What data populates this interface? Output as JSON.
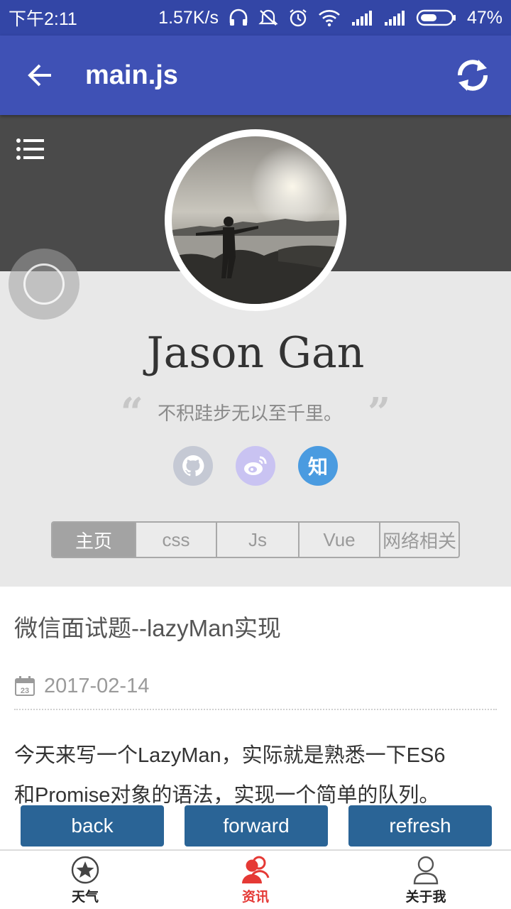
{
  "status_bar": {
    "time": "下午2:11",
    "network_speed": "1.57K/s",
    "battery": "47%",
    "icons": [
      "headset-icon",
      "mute-icon",
      "alarm-icon",
      "wifi-icon",
      "signal-icon",
      "signal-icon",
      "battery-icon"
    ]
  },
  "app_bar": {
    "title": "main.js",
    "back_icon": "arrow-left-icon",
    "refresh_icon": "refresh-icon"
  },
  "profile": {
    "name": "Jason Gan",
    "motto": "不积跬步无以至千里。",
    "quote_open": "“",
    "quote_close": "”",
    "socials": [
      {
        "name": "github",
        "icon": "github-icon",
        "color": "#c5c9d4"
      },
      {
        "name": "weibo",
        "icon": "weibo-icon",
        "color": "#c9c3f2"
      },
      {
        "name": "zhihu",
        "label": "知",
        "color": "#4a9be0"
      }
    ]
  },
  "tabs": [
    {
      "label": "主页",
      "active": true
    },
    {
      "label": "css",
      "active": false
    },
    {
      "label": "Js",
      "active": false
    },
    {
      "label": "Vue",
      "active": false
    },
    {
      "label": "网络相关",
      "active": false
    }
  ],
  "article": {
    "title": "微信面试题--lazyMan实现",
    "date": "2017-02-14",
    "calendar_day": "23",
    "body_line1": "今天来写一个LazyMan，实际就是熟悉一下ES6",
    "body_line2": "和Promise对象的语法，实现一个简单的队列。"
  },
  "web_controls": {
    "back": "back",
    "forward": "forward",
    "refresh": "refresh"
  },
  "bottom_nav": [
    {
      "label": "天气",
      "icon": "star-icon",
      "active": false
    },
    {
      "label": "资讯",
      "icon": "people-icon",
      "active": true
    },
    {
      "label": "关于我",
      "icon": "person-icon",
      "active": false
    }
  ],
  "colors": {
    "status_bar": "#3346a6",
    "app_bar": "#3f51b5",
    "web_button": "#2a6496",
    "nav_active": "#e53935"
  }
}
